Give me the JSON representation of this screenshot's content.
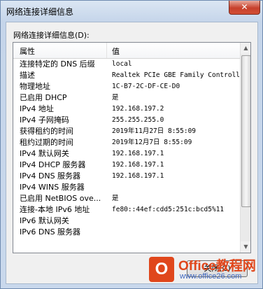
{
  "window": {
    "title": "网络连接详细信息",
    "close_symbol": "✕"
  },
  "group_label": "网络连接详细信息(D):",
  "table": {
    "columns": [
      "属性",
      "值"
    ],
    "rows": [
      [
        "连接特定的 DNS 后缀",
        "local"
      ],
      [
        "描述",
        "Realtek PCIe GBE Family Controller"
      ],
      [
        "物理地址",
        "1C-B7-2C-DF-CE-D0"
      ],
      [
        "已启用 DHCP",
        "是"
      ],
      [
        "IPv4 地址",
        "192.168.197.2"
      ],
      [
        "IPv4 子网掩码",
        "255.255.255.0"
      ],
      [
        "获得租约的时间",
        "2019年11月27日 8:55:09"
      ],
      [
        "租约过期的时间",
        "2019年12月7日 8:55:09"
      ],
      [
        "IPv4 默认网关",
        "192.168.197.1"
      ],
      [
        "IPv4 DHCP 服务器",
        "192.168.197.1"
      ],
      [
        "IPv4 DNS 服务器",
        "192.168.197.1"
      ],
      [
        "IPv4 WINS 服务器",
        ""
      ],
      [
        "已启用 NetBIOS ove...",
        "是"
      ],
      [
        "连接-本地 IPv6 地址",
        "fe80::44ef:cdd5:251c:bcd5%11"
      ],
      [
        "IPv6 默认网关",
        ""
      ],
      [
        "IPv6 DNS 服务器",
        ""
      ]
    ]
  },
  "close_button_label": "关闭(C)",
  "watermark": {
    "logo": "O",
    "name": "Office教程网",
    "url": "www.office26.com"
  }
}
